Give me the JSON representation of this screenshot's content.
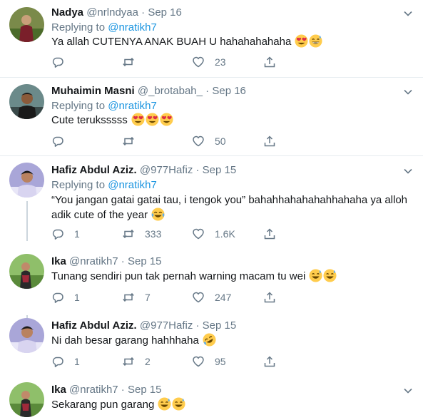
{
  "tweets": [
    {
      "name": "Nadya",
      "handle": "@nrlndyaa",
      "dot": "·",
      "date": "Sep 16",
      "replying_label": "Replying to",
      "replying_to": "@nratikh7",
      "text": "Ya allah CUTENYA ANAK BUAH U hahahahahaha",
      "emojis": [
        "heart-eyes",
        "grin-sweat"
      ],
      "replies": "",
      "retweets": "",
      "likes": "23"
    },
    {
      "name": "Muhaimin Masni",
      "handle": "@_brotabah_",
      "dot": "·",
      "date": "Sep 16",
      "replying_label": "Replying to",
      "replying_to": "@nratikh7",
      "text": "Cute teruksssss",
      "emojis": [
        "heart-eyes",
        "heart-eyes",
        "heart-eyes"
      ],
      "replies": "",
      "retweets": "",
      "likes": "50"
    },
    {
      "name": "Hafiz Abdul Aziz.",
      "handle": "@977Hafiz",
      "dot": "·",
      "date": "Sep 15",
      "replying_label": "Replying to",
      "replying_to": "@nratikh7",
      "text": "“You jangan gatai gatai tau, i tengok you” bahahhahahahahhahaha ya alloh adik cute of the year",
      "emojis": [
        "joy"
      ],
      "replies": "1",
      "retweets": "333",
      "likes": "1.6K"
    },
    {
      "name": "Ika",
      "handle": "@nratikh7",
      "dot": "·",
      "date": "Sep 15",
      "text": "Tunang sendiri pun tak pernah warning macam tu wei",
      "emojis": [
        "grin-sweat",
        "grin-sweat"
      ],
      "replies": "1",
      "retweets": "7",
      "likes": "247"
    },
    {
      "name": "Hafiz Abdul Aziz.",
      "handle": "@977Hafiz",
      "dot": "·",
      "date": "Sep 15",
      "text": "Ni dah besar garang hahhhaha",
      "emojis": [
        "rofl"
      ],
      "replies": "1",
      "retweets": "2",
      "likes": "95"
    },
    {
      "name": "Ika",
      "handle": "@nratikh7",
      "dot": "·",
      "date": "Sep 15",
      "text": "Sekarang pun garang",
      "emojis": [
        "grin-sweat",
        "grin-sweat"
      ]
    }
  ],
  "colors": {
    "text": "#14171a",
    "muted": "#657786",
    "link": "#1b95e0",
    "separator": "#e6ecf0",
    "thread": "#ccd6dd"
  }
}
